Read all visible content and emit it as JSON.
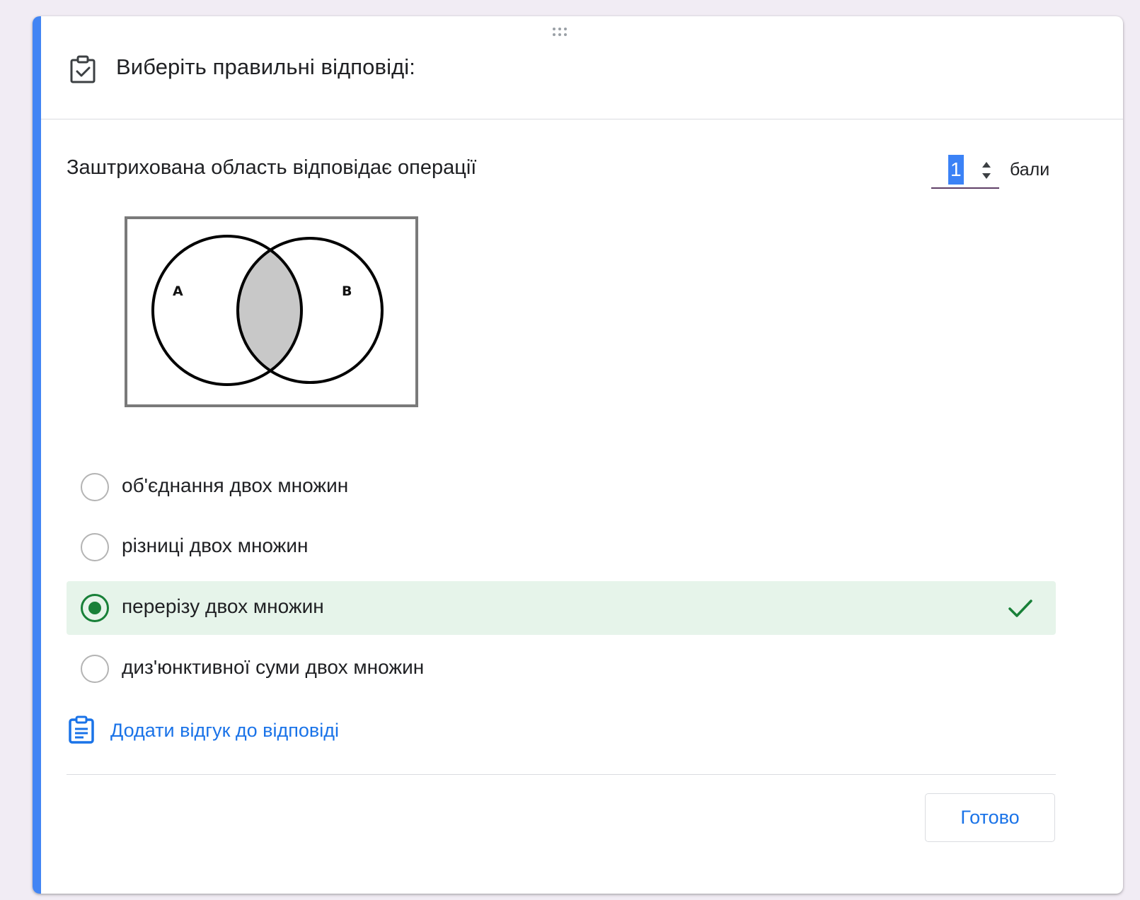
{
  "header": {
    "title": "Виберіть правильні відповіді:",
    "icon": "checklist-icon"
  },
  "question": {
    "text": "Заштрихована область відповідає операції",
    "points": {
      "value": "1",
      "unit": "бали"
    }
  },
  "image": {
    "label_a": "A",
    "label_b": "B",
    "shaded_region": "intersection"
  },
  "options": [
    {
      "label": "об'єднання двох множин",
      "selected": false,
      "correct": false
    },
    {
      "label": "різниці двох множин",
      "selected": false,
      "correct": false
    },
    {
      "label": "перерізу двох множин",
      "selected": true,
      "correct": true
    },
    {
      "label": "диз'юнктивної суми двох множин",
      "selected": false,
      "correct": false
    }
  ],
  "feedback": {
    "label": "Додати відгук до відповіді"
  },
  "footer": {
    "done_label": "Готово"
  },
  "colors": {
    "accent": "#4285f4",
    "correct_bg": "#e6f4ea",
    "correct_green": "#188038",
    "link_blue": "#1a73e8"
  }
}
